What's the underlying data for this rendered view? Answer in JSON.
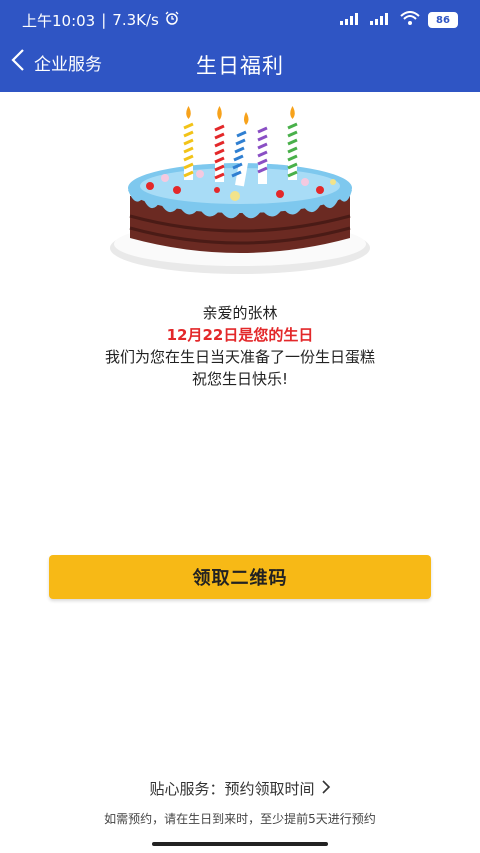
{
  "status_bar": {
    "time": "上午10:03",
    "separator": "|",
    "speed": "7.3K/s",
    "icons": [
      "alarm-icon",
      "signal-icon",
      "signal-icon",
      "wifi-icon"
    ],
    "battery": "86"
  },
  "nav": {
    "back_label": "企业服务",
    "title": "生日福利"
  },
  "message": {
    "greeting": "亲爱的张林",
    "birthday": "12月22日是您的生日",
    "line3": "我们为您在生日当天准备了一份生日蛋糕",
    "line4": "祝您生日快乐!"
  },
  "button": {
    "label": "领取二维码"
  },
  "footer": {
    "service": "贴心服务：预约领取时间",
    "note": "如需预约，请在生日到来时，至少提前5天进行预约"
  },
  "colors": {
    "header": "#2f55c4",
    "button": "#f7b916",
    "highlight": "#e3282a"
  }
}
